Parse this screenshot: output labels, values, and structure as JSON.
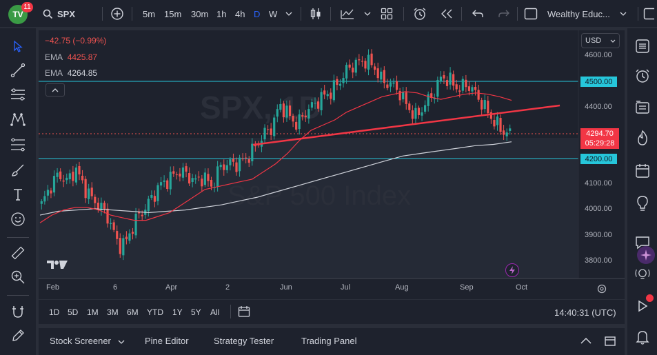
{
  "header": {
    "logo_text": "TV",
    "notifications": "11",
    "symbol": "SPX",
    "intervals": [
      "5m",
      "15m",
      "30m",
      "1h",
      "4h",
      "D",
      "W"
    ],
    "active_interval": "D",
    "layout_name": "Wealthy Educ..."
  },
  "legend": {
    "change": "−42.75 (−0.99%)",
    "ema1_label": "EMA",
    "ema1_value": "4425.87",
    "ema2_label": "EMA",
    "ema2_value": "4264.85"
  },
  "watermark": {
    "symbol": "SPX, 1D",
    "name": "S&P 500 Index"
  },
  "price_axis": {
    "currency": "USD",
    "labels": [
      "4600.00",
      "4400.00",
      "4100.00",
      "4000.00",
      "3900.00",
      "3800.00"
    ],
    "tag_4500": "4500.00",
    "tag_4200": "4200.00",
    "current_price": "4294.70",
    "countdown": "05:29:28"
  },
  "time_axis": {
    "labels": [
      "Feb",
      "6",
      "Apr",
      "2",
      "Jun",
      "Jul",
      "Aug",
      "Sep",
      "Oct"
    ]
  },
  "chart_data": {
    "type": "candlestick",
    "symbol": "SPX",
    "interval": "1D",
    "last_price": 4294.7,
    "change": -42.75,
    "change_pct": -0.99,
    "ema_fast": 4425.87,
    "ema_slow": 4264.85,
    "horizontal_levels": [
      4500,
      4200
    ],
    "trendline": {
      "start_month": "May",
      "start_price": 4150,
      "end_month": "Oct",
      "end_price": 4400
    },
    "ylim": [
      3760,
      4640
    ],
    "close_path": [
      4020,
      4090,
      4140,
      4110,
      4160,
      4090,
      4040,
      4010,
      3960,
      3860,
      3880,
      3960,
      4000,
      4050,
      4100,
      4120,
      4150,
      4140,
      4110,
      4130,
      4090,
      4170,
      4180,
      4180,
      4200,
      4240,
      4290,
      4320,
      4410,
      4370,
      4330,
      4380,
      4410,
      4440,
      4460,
      4500,
      4550,
      4570,
      4580,
      4560,
      4500,
      4490,
      4460,
      4400,
      4360,
      4410,
      4450,
      4520,
      4500,
      4470,
      4490,
      4450,
      4400,
      4350,
      4310,
      4295
    ],
    "ema_fast_path": [
      3950,
      3980,
      4000,
      4010,
      4010,
      4000,
      3980,
      3970,
      3960,
      3960,
      3975,
      3990,
      4020,
      4050,
      4080,
      4090,
      4100,
      4110,
      4120,
      4150,
      4180,
      4220,
      4270,
      4310,
      4330,
      4350,
      4380,
      4400,
      4420,
      4440,
      4450,
      4460,
      4455,
      4440,
      4430,
      4440,
      4450,
      4455,
      4450,
      4440,
      4426
    ],
    "ema_slow_path": [
      3980,
      3995,
      4000,
      4005,
      4000,
      3995,
      3990,
      3995,
      4000,
      4010,
      4020,
      4035,
      4050,
      4070,
      4090,
      4110,
      4130,
      4150,
      4170,
      4190,
      4210,
      4220,
      4230,
      4240,
      4250,
      4255,
      4265
    ]
  },
  "range_buttons": [
    "1D",
    "5D",
    "1M",
    "3M",
    "6M",
    "YTD",
    "1Y",
    "5Y",
    "All"
  ],
  "clock": "14:40:31 (UTC)",
  "panel_tabs": [
    "Stock Screener",
    "Pine Editor",
    "Strategy Tester",
    "Trading Panel"
  ],
  "colors": {
    "up": "#26a69a",
    "down": "#ef5350",
    "level_line": "#26c6da",
    "trendline": "#f23645",
    "ema_fast": "#f23645",
    "ema_slow": "#d1d4dc",
    "accent": "#2962ff"
  }
}
